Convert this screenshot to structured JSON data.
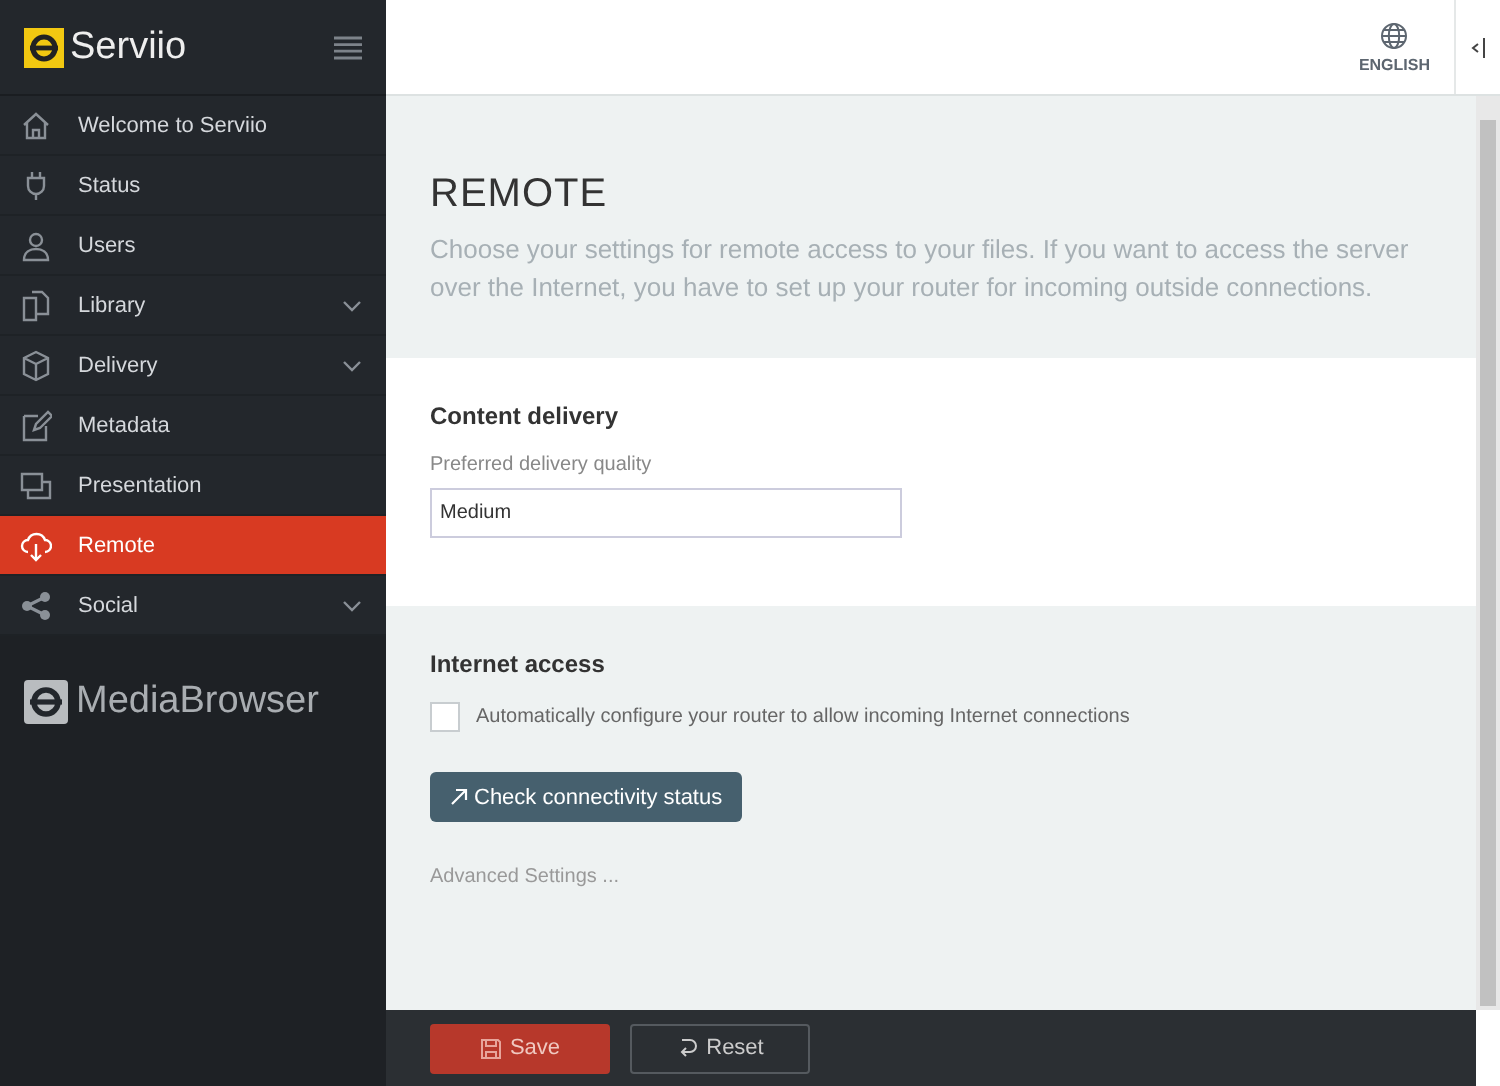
{
  "app": {
    "name": "Serviio"
  },
  "sidebar": {
    "items": [
      {
        "label": "Welcome to Serviio",
        "selected": false
      },
      {
        "label": "Status",
        "selected": false
      },
      {
        "label": "Users",
        "selected": false
      },
      {
        "label": "Library",
        "selected": false,
        "expanded": false
      },
      {
        "label": "Delivery",
        "selected": false,
        "expanded": false
      },
      {
        "label": "Metadata",
        "selected": false
      },
      {
        "label": "Presentation",
        "selected": false
      },
      {
        "label": "Remote",
        "selected": true
      },
      {
        "label": "Social",
        "selected": false,
        "expanded": false
      }
    ],
    "brand": "MediaBrowser"
  },
  "header": {
    "language": "ENGLISH"
  },
  "page": {
    "title": "REMOTE",
    "description": "Choose your settings for remote access to your files. If you want to access the server over the Internet, you have to set up your router for incoming outside connections."
  },
  "content_delivery": {
    "heading": "Content delivery",
    "field_label": "Preferred delivery quality",
    "value": "Medium"
  },
  "internet_access": {
    "heading": "Internet access",
    "checkbox": {
      "label": "Automatically configure your router to allow incoming Internet connections",
      "checked": false
    },
    "button": "Check connectivity status",
    "link": "Advanced Settings ..."
  },
  "footer": {
    "buttons": [
      {
        "label": "Save",
        "kind": "primary"
      },
      {
        "label": "Reset",
        "kind": "secondary"
      }
    ]
  }
}
